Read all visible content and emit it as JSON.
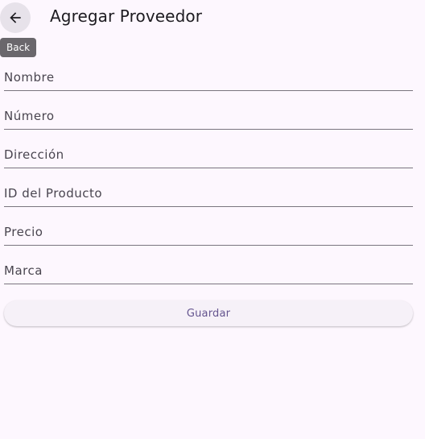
{
  "header": {
    "title": "Agregar Proveedor",
    "back_tooltip": "Back",
    "back_icon": "arrow-left-icon"
  },
  "form": {
    "fields": [
      {
        "placeholder": "Nombre",
        "value": ""
      },
      {
        "placeholder": "Número",
        "value": ""
      },
      {
        "placeholder": "Dirección",
        "value": ""
      },
      {
        "placeholder": "ID del Producto",
        "value": ""
      },
      {
        "placeholder": "Precio",
        "value": ""
      },
      {
        "placeholder": "Marca",
        "value": ""
      }
    ],
    "save_label": "Guardar"
  },
  "colors": {
    "background": "#fdf7fe",
    "accent": "#65558f",
    "underline": "#7a757f",
    "tooltip_bg": "#6a676c"
  }
}
